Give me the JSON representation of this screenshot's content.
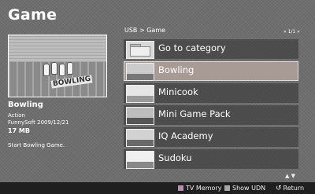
{
  "header": {
    "title": "Game"
  },
  "preview": {
    "banner": "BOWLING",
    "name": "Bowling",
    "genre": "Action",
    "maker_date": "FunnySoft 2009/12/21",
    "size": "17 MB",
    "description": "Start Bowling Game."
  },
  "browser": {
    "breadcrumb": "USB > Game",
    "page_indicator": "« 1/1 »",
    "items": [
      {
        "label": "Go to category",
        "icon": "folder-icon",
        "selected": false
      },
      {
        "label": "Bowling",
        "icon": "bowling-thumbnail",
        "selected": true
      },
      {
        "label": "Minicook",
        "icon": "minicook-thumbnail",
        "selected": false
      },
      {
        "label": "Mini Game Pack",
        "icon": "minigamepack-thumbnail",
        "selected": false
      },
      {
        "label": "IQ Academy",
        "icon": "iqacademy-thumbnail",
        "selected": false
      },
      {
        "label": "Sudoku",
        "icon": "sudoku-thumbnail",
        "selected": false
      }
    ],
    "scroll_hint": "▲ ▼"
  },
  "footer": {
    "tv_memory": "TV Memory",
    "show_udn": "Show UDN",
    "return": "Return"
  },
  "colors": {
    "selected_row": "#a89a94",
    "tv_memory_key": "#b58dae",
    "show_udn_key": "#a7a7a7"
  }
}
